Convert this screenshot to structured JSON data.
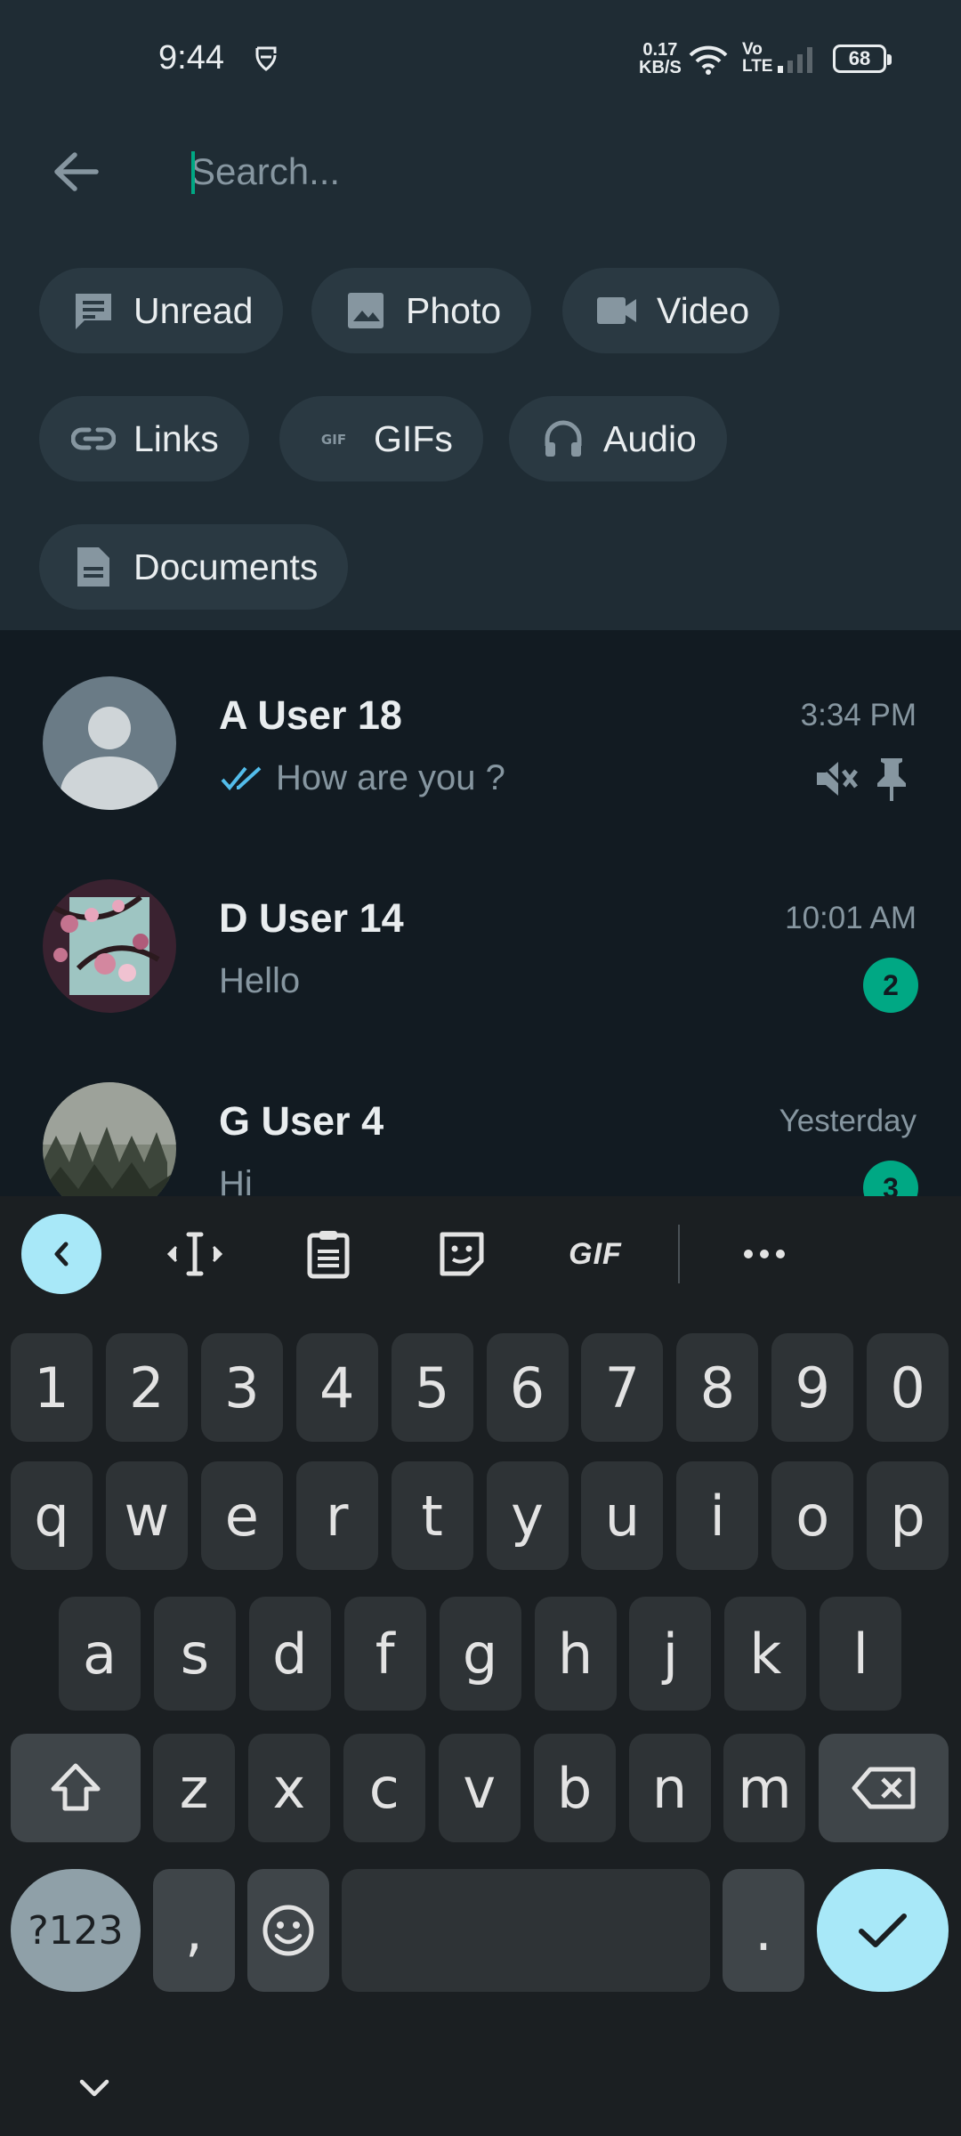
{
  "status_bar": {
    "time": "9:44",
    "net_speed_value": "0.17",
    "net_speed_unit": "KB/S",
    "battery": "68"
  },
  "search": {
    "placeholder": "Search..."
  },
  "filters": [
    {
      "label": "Unread",
      "icon": "unread-chat-icon"
    },
    {
      "label": "Photo",
      "icon": "photo-icon"
    },
    {
      "label": "Video",
      "icon": "video-icon"
    },
    {
      "label": "Links",
      "icon": "link-icon"
    },
    {
      "label": "GIFs",
      "icon": "gif-icon"
    },
    {
      "label": "Audio",
      "icon": "headphones-icon"
    },
    {
      "label": "Documents",
      "icon": "document-icon"
    }
  ],
  "chats": [
    {
      "name": "A User 18",
      "time": "3:34 PM",
      "message": "How are you ?",
      "read_ticks": true,
      "muted": true,
      "pinned": true
    },
    {
      "name": "D User 14",
      "time": "10:01 AM",
      "message": "Hello",
      "unread": "2"
    },
    {
      "name": "G User 4",
      "time": "Yesterday",
      "message": "Hi",
      "unread": "3"
    }
  ],
  "keyboard": {
    "gif_label": "GIF",
    "row_numbers": [
      "1",
      "2",
      "3",
      "4",
      "5",
      "6",
      "7",
      "8",
      "9",
      "0"
    ],
    "row_1": [
      "q",
      "w",
      "e",
      "r",
      "t",
      "y",
      "u",
      "i",
      "o",
      "p"
    ],
    "row_2": [
      "a",
      "s",
      "d",
      "f",
      "g",
      "h",
      "j",
      "k",
      "l"
    ],
    "row_3": [
      "z",
      "x",
      "c",
      "v",
      "b",
      "n",
      "m"
    ],
    "symbols_label": "?123",
    "comma": ",",
    "period": "."
  },
  "colors": {
    "header_bg": "#1f2c34",
    "list_bg": "#121b22",
    "accent": "#00a884",
    "tick_blue": "#53bdeb"
  }
}
